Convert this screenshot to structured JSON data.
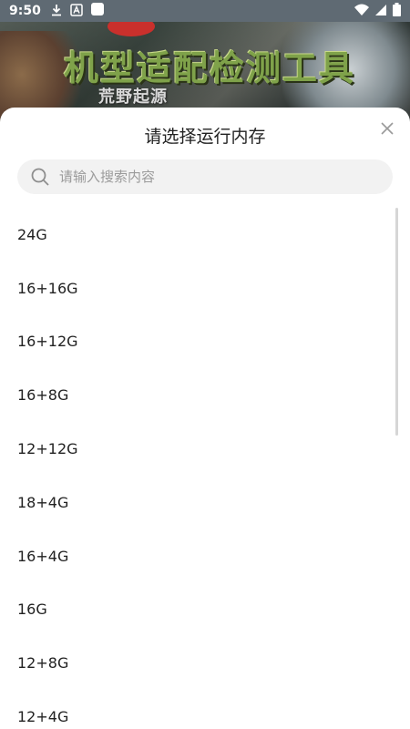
{
  "status_bar": {
    "time": "9:50",
    "left_icons": [
      "download-icon",
      "font-a-icon",
      "app-square-icon"
    ],
    "right_icons": [
      "wifi-icon",
      "signal-icon",
      "battery-icon"
    ]
  },
  "banner": {
    "title": "机型适配检测工具",
    "subtitle": "荒野起源",
    "title_color": "#7fa24a"
  },
  "sheet": {
    "title": "请选择运行内存",
    "close_icon": "close-icon",
    "search": {
      "value": "",
      "placeholder": "请输入搜索内容",
      "icon": "search-icon"
    },
    "options": [
      "24G",
      "16+16G",
      "16+12G",
      "16+8G",
      "12+12G",
      "18+4G",
      "16+4G",
      "16G",
      "12+8G",
      "12+4G"
    ]
  }
}
